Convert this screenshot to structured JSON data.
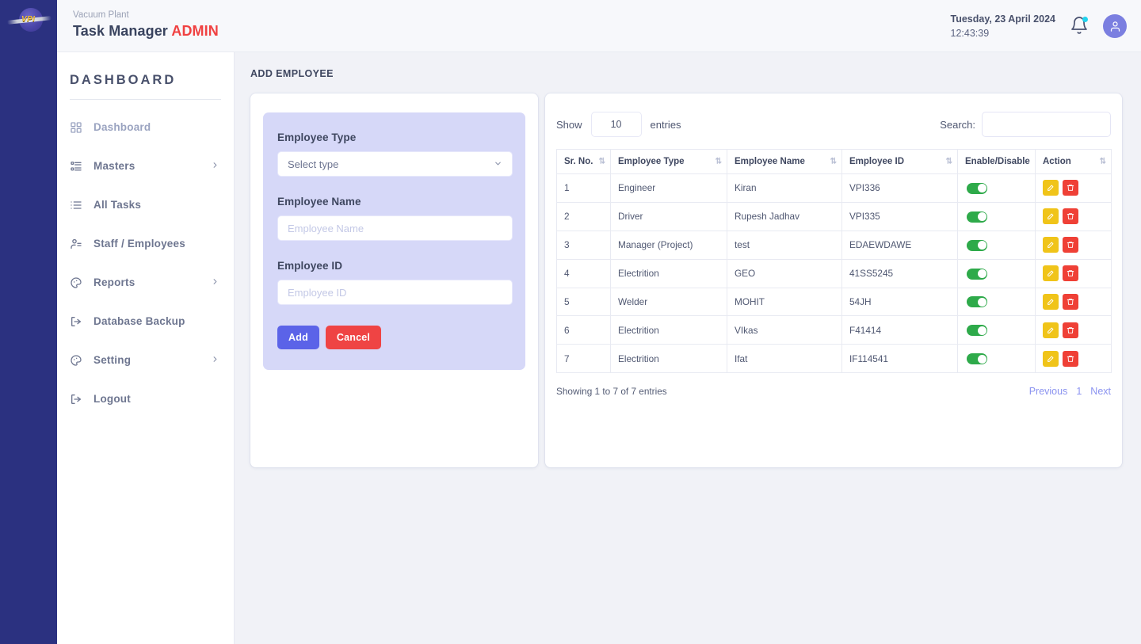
{
  "brand": {
    "logo_text": "VPI",
    "subtitle": "Vacuum Plant",
    "title": "Task Manager",
    "role": "ADMIN"
  },
  "header": {
    "date": "Tuesday, 23 April 2024",
    "time": "12:43:39",
    "notification_icon": "bell-icon",
    "avatar_icon": "user-icon"
  },
  "sidebar": {
    "title": "DASHBOARD",
    "items": [
      {
        "label": "Dashboard",
        "icon": "grid-icon",
        "has_submenu": false,
        "muted": true
      },
      {
        "label": "Masters",
        "icon": "list-detail-icon",
        "has_submenu": true,
        "muted": false
      },
      {
        "label": "All Tasks",
        "icon": "list-icon",
        "has_submenu": false,
        "muted": false
      },
      {
        "label": "Staff / Employees",
        "icon": "user-list-icon",
        "has_submenu": false,
        "muted": false
      },
      {
        "label": "Reports",
        "icon": "palette-icon",
        "has_submenu": true,
        "muted": false
      },
      {
        "label": "Database Backup",
        "icon": "logout-icon",
        "has_submenu": false,
        "muted": false
      },
      {
        "label": "Setting",
        "icon": "palette-icon",
        "has_submenu": true,
        "muted": false
      },
      {
        "label": "Logout",
        "icon": "logout-icon",
        "has_submenu": false,
        "muted": false
      }
    ]
  },
  "page": {
    "title": "ADD EMPLOYEE"
  },
  "form": {
    "employee_type": {
      "label": "Employee Type",
      "value": "Select type",
      "icon": "chevron-down-icon"
    },
    "employee_name": {
      "label": "Employee Name",
      "value": "",
      "placeholder": "Employee Name"
    },
    "employee_id": {
      "label": "Employee ID",
      "value": "",
      "placeholder": "Employee ID"
    },
    "add_label": "Add",
    "cancel_label": "Cancel",
    "panel_color": "#d6d8f8",
    "add_color": "#5b63e8",
    "cancel_color": "#ef4444"
  },
  "table": {
    "show_label": "Show",
    "entries_label": "entries",
    "page_size": "10",
    "search_label": "Search:",
    "search_value": "",
    "search_placeholder": "",
    "columns": [
      "Sr. No.",
      "Employee Type",
      "Employee Name",
      "Employee ID",
      "Enable/Disable",
      "Action"
    ],
    "rows": [
      {
        "sr": "1",
        "type": "Engineer",
        "name": "Kiran",
        "id": "VPI336",
        "enabled": true
      },
      {
        "sr": "2",
        "type": "Driver",
        "name": "Rupesh Jadhav",
        "id": "VPI335",
        "enabled": true
      },
      {
        "sr": "3",
        "type": "Manager (Project)",
        "name": "test",
        "id": "EDAEWDAWE",
        "enabled": true
      },
      {
        "sr": "4",
        "type": "Electrition",
        "name": "GEO",
        "id": "41SS5245",
        "enabled": true
      },
      {
        "sr": "5",
        "type": "Welder",
        "name": "MOHIT",
        "id": "54JH",
        "enabled": true
      },
      {
        "sr": "6",
        "type": "Electrition",
        "name": "VIkas",
        "id": "F41414",
        "enabled": true
      },
      {
        "sr": "7",
        "type": "Electrition",
        "name": "Ifat",
        "id": "IF114541",
        "enabled": true
      }
    ],
    "info": "Showing 1 to 7 of 7 entries",
    "pagination": {
      "previous": "Previous",
      "current": "1",
      "next": "Next"
    },
    "toggle_on_color": "#2eaa4a",
    "edit_color": "#f0c419",
    "delete_color": "#ef4036"
  }
}
